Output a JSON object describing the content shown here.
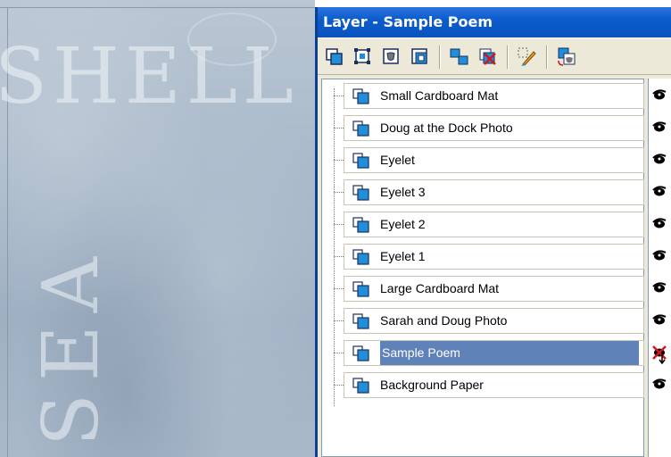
{
  "canvas": {
    "word_top": "SHELL",
    "word_side": "SEA"
  },
  "palette": {
    "title": "Layer - Sample Poem",
    "toolbar": [
      {
        "name": "new-raster-layer-icon"
      },
      {
        "name": "new-vector-layer-icon"
      },
      {
        "name": "new-mask-layer-icon"
      },
      {
        "name": "new-adjustment-layer-icon"
      },
      {
        "name": "duplicate-layer-icon"
      },
      {
        "name": "delete-layer-icon"
      },
      {
        "name": "edit-selection-icon"
      },
      {
        "name": "layer-properties-icon"
      }
    ],
    "layers": [
      {
        "label": "Small Cardboard Mat",
        "visible": true,
        "selected": false
      },
      {
        "label": "Doug at the Dock Photo",
        "visible": true,
        "selected": false
      },
      {
        "label": "Eyelet",
        "visible": true,
        "selected": false
      },
      {
        "label": "Eyelet 3",
        "visible": true,
        "selected": false
      },
      {
        "label": "Eyelet 2",
        "visible": true,
        "selected": false
      },
      {
        "label": "Eyelet 1",
        "visible": true,
        "selected": false
      },
      {
        "label": "Large Cardboard Mat",
        "visible": true,
        "selected": false
      },
      {
        "label": "Sarah and Doug Photo",
        "visible": true,
        "selected": false
      },
      {
        "label": "Sample Poem",
        "visible": false,
        "selected": true
      },
      {
        "label": "Background Paper",
        "visible": true,
        "selected": false
      }
    ],
    "colors": {
      "titlebar": "#0a57c6",
      "selection": "#5f82b8",
      "layer_icon": "#1e8fd8"
    }
  }
}
